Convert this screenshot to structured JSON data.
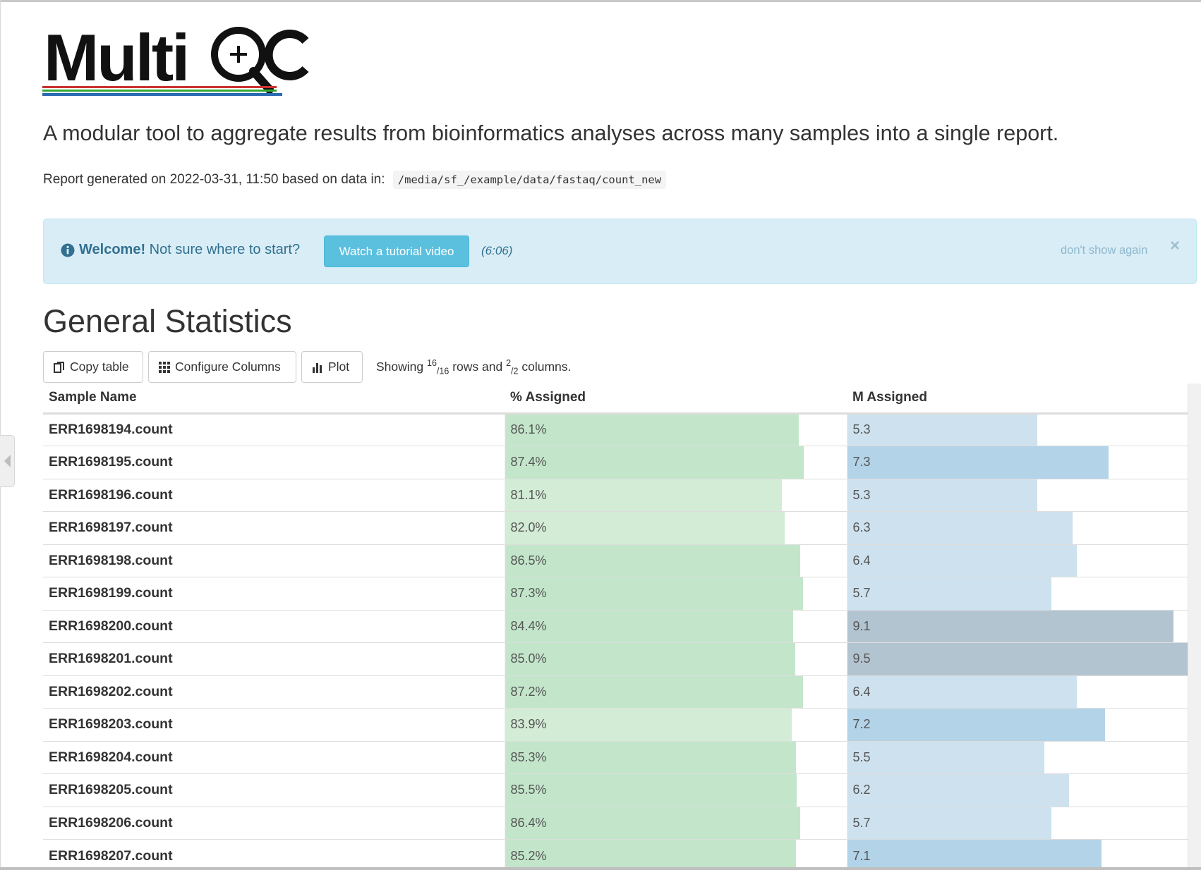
{
  "header": {
    "logo_text": "MultiQC",
    "intro": "A modular tool to aggregate results from bioinformatics analyses across many samples into a single report.",
    "generated_prefix": "Report generated on 2022-03-31, 11:50 based on data in:",
    "data_path": "/media/sf_/example/data/fastaq/count_new"
  },
  "welcome_alert": {
    "bold": "Welcome!",
    "text": "Not sure where to start?",
    "button_label": "Watch a tutorial video",
    "duration": "(6:06)",
    "dismiss_label": "don't show again",
    "close_glyph": "×"
  },
  "general_stats": {
    "title": "General Statistics",
    "copy_label": "Copy table",
    "configure_label": "Configure Columns",
    "plot_label": "Plot",
    "showing_prefix": "Showing",
    "rows_shown": "16",
    "rows_total": "/16",
    "rows_word": "rows and",
    "cols_shown": "2",
    "cols_total": "/2",
    "cols_word": "columns.",
    "columns": [
      "Sample Name",
      "% Assigned",
      "M Assigned"
    ],
    "rows": [
      {
        "sample": "ERR1698194.count",
        "pct_assigned": "86.1%",
        "pct": 86.1,
        "m_assigned": "5.3",
        "m": 5.3
      },
      {
        "sample": "ERR1698195.count",
        "pct_assigned": "87.4%",
        "pct": 87.4,
        "m_assigned": "7.3",
        "m": 7.3
      },
      {
        "sample": "ERR1698196.count",
        "pct_assigned": "81.1%",
        "pct": 81.1,
        "m_assigned": "5.3",
        "m": 5.3
      },
      {
        "sample": "ERR1698197.count",
        "pct_assigned": "82.0%",
        "pct": 82.0,
        "m_assigned": "6.3",
        "m": 6.3
      },
      {
        "sample": "ERR1698198.count",
        "pct_assigned": "86.5%",
        "pct": 86.5,
        "m_assigned": "6.4",
        "m": 6.4
      },
      {
        "sample": "ERR1698199.count",
        "pct_assigned": "87.3%",
        "pct": 87.3,
        "m_assigned": "5.7",
        "m": 5.7
      },
      {
        "sample": "ERR1698200.count",
        "pct_assigned": "84.4%",
        "pct": 84.4,
        "m_assigned": "9.1",
        "m": 9.1
      },
      {
        "sample": "ERR1698201.count",
        "pct_assigned": "85.0%",
        "pct": 85.0,
        "m_assigned": "9.5",
        "m": 9.5
      },
      {
        "sample": "ERR1698202.count",
        "pct_assigned": "87.2%",
        "pct": 87.2,
        "m_assigned": "6.4",
        "m": 6.4
      },
      {
        "sample": "ERR1698203.count",
        "pct_assigned": "83.9%",
        "pct": 83.9,
        "m_assigned": "7.2",
        "m": 7.2
      },
      {
        "sample": "ERR1698204.count",
        "pct_assigned": "85.3%",
        "pct": 85.3,
        "m_assigned": "5.5",
        "m": 5.5
      },
      {
        "sample": "ERR1698205.count",
        "pct_assigned": "85.5%",
        "pct": 85.5,
        "m_assigned": "6.2",
        "m": 6.2
      },
      {
        "sample": "ERR1698206.count",
        "pct_assigned": "86.4%",
        "pct": 86.4,
        "m_assigned": "5.7",
        "m": 5.7
      },
      {
        "sample": "ERR1698207.count",
        "pct_assigned": "85.2%",
        "pct": 85.2,
        "m_assigned": "7.1",
        "m": 7.1
      }
    ]
  },
  "colors": {
    "alert_bg": "#d9edf7",
    "alert_text": "#31708f",
    "tutorial_button": "#5bc0de",
    "pct_bar_high": "#c3e6cb",
    "pct_bar_low": "#d3ecd6",
    "m_bar_high": "#b3c4d1",
    "m_bar_mid": "#b3d3e8",
    "m_bar_low": "#cde2ee"
  }
}
